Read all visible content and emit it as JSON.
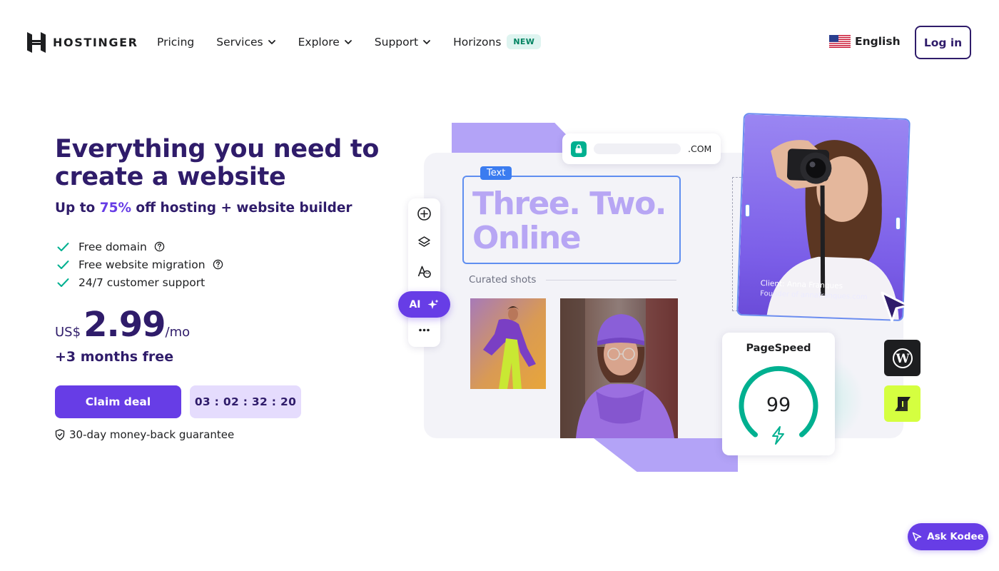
{
  "header": {
    "brand": "HOSTINGER",
    "nav": [
      {
        "label": "Pricing"
      },
      {
        "label": "Services"
      },
      {
        "label": "Explore"
      },
      {
        "label": "Support"
      },
      {
        "label": "Horizons",
        "badge": "NEW"
      }
    ],
    "language": "English",
    "login_label": "Log in"
  },
  "hero": {
    "title": "Everything you need to create a website",
    "subtitle_prefix": "Up to ",
    "subtitle_accent": "75%",
    "subtitle_suffix": " off hosting + website builder",
    "features": [
      {
        "label": "Free domain",
        "help": true
      },
      {
        "label": "Free website migration",
        "help": true
      },
      {
        "label": "24/7 customer support",
        "help": false
      }
    ],
    "price": {
      "currency": "US$",
      "amount": "2.99",
      "period": "/mo"
    },
    "bonus": "+3 months free",
    "cta_label": "Claim deal",
    "countdown": "03 : 02 : 32 : 20",
    "guarantee": "30-day money-back guarantee"
  },
  "illustration": {
    "url_domain": ".COM",
    "text_tag": "Text",
    "headline_line1": "Three. Two.",
    "headline_line2": "Online",
    "section_label": "Curated shots",
    "ai_label": "AI",
    "client_name": "Client: Anna Franques",
    "client_role": "Founder of annafranques.com",
    "pagespeed_title": "PageSpeed",
    "pagespeed_score": "99"
  },
  "chat": {
    "label": "Ask Kodee"
  },
  "colors": {
    "brand_purple": "#673de6",
    "dark_purple": "#2f1c6a",
    "check_green": "#00b090",
    "lime": "#d5ff40"
  },
  "icons": [
    "hostinger-logo-icon",
    "chevron-down-icon",
    "us-flag-icon",
    "check-icon",
    "help-circle-icon",
    "shield-icon",
    "lock-icon",
    "add-circle-icon",
    "layers-icon",
    "style-icon",
    "sparkle-icon",
    "more-icon",
    "cursor-icon",
    "bolt-icon",
    "wordpress-icon",
    "cms-icon",
    "kodee-icon"
  ]
}
